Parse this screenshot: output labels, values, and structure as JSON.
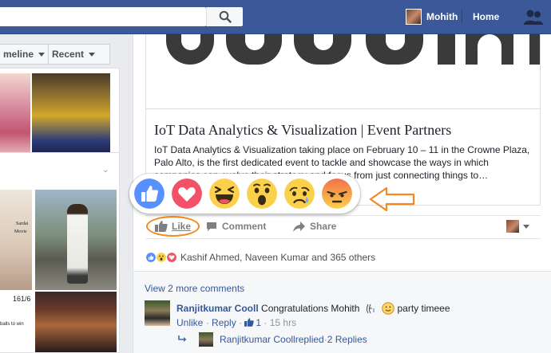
{
  "topbar": {
    "profile_name": "Mohith",
    "home_label": "Home",
    "search_placeholder": ""
  },
  "left": {
    "tabs": [
      {
        "label": "meline"
      },
      {
        "label": "Recent"
      }
    ],
    "friend_card_texts": {
      "sardar": "Sardai",
      "movie": "Movie",
      "number": "161/6",
      "balls": "balls to win"
    }
  },
  "post": {
    "link_title": "IoT Data Analytics & Visualization | Event Partners",
    "link_description": "IoT Data Analytics & Visualization taking place on February 10 – 11 in the Crowne Plaza, Palo Alto, is the first dedicated event to tackle and showcase the ways in which companies can evolve their strategy and focus from just connecting things to…",
    "actions": {
      "like": "Like",
      "comment": "Comment",
      "share": "Share"
    },
    "reactions_summary": "Kashif Ahmed, Naveen Kumar and 365 others",
    "reaction_popup": [
      "like-reaction",
      "love-reaction",
      "haha-reaction",
      "wow-reaction",
      "sad-reaction",
      "angry-reaction"
    ]
  },
  "comments": {
    "view_more": "View 2 more comments",
    "comment": {
      "author": "Ranjitkumar Cooll",
      "text": " Congratulations Mohith",
      "text_tail": " party timeee",
      "unlike": "Unlike",
      "reply": "Reply",
      "likes": "1",
      "time": "15 hrs",
      "dot": " · "
    },
    "reply_summary": {
      "author": "Ranjitkumar Cooll",
      "action": " replied",
      "count": "2 Replies",
      "dot": " · "
    }
  },
  "colors": {
    "brand_blue": "#3b5998",
    "link_blue": "#365899",
    "highlight_orange": "#f4891f",
    "reaction_like": "#5890ff",
    "reaction_love": "#f25268",
    "reaction_yellow": "#fbd14b",
    "reaction_angry": "#f2714b"
  }
}
